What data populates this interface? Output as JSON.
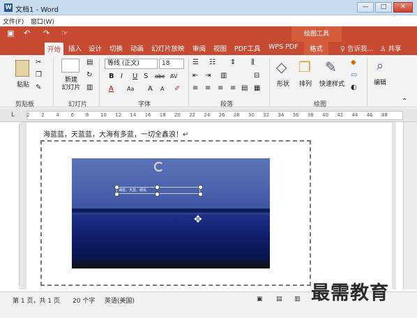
{
  "window": {
    "title": "文档1 - Word",
    "app_icon": "W",
    "min_label": "—",
    "max_label": "□",
    "close_label": "✕"
  },
  "menu": [
    "文件(F)",
    "窗口(W)"
  ],
  "qat": {
    "save": "▣",
    "undo": "↶",
    "redo": "↷",
    "custom": "☞"
  },
  "context_header": "绘图工具",
  "tabs": [
    "开始",
    "插入",
    "设计",
    "切换",
    "动画",
    "幻灯片放映",
    "审阅",
    "视图",
    "PDF工具",
    "WPS PDF",
    "格式"
  ],
  "tell_me": "告诉我...",
  "share": "共享",
  "ribbon": {
    "clipboard": {
      "paste": "粘贴",
      "group": "剪贴板"
    },
    "slides": {
      "new_slide": "新建\n幻灯片",
      "group": "幻灯片"
    },
    "font": {
      "font_name": "等线 (正文)",
      "font_size": "18",
      "group": "字体",
      "bold": "B",
      "italic": "I",
      "underline": "U",
      "strike": "S",
      "abc": "abc",
      "av": "AV",
      "fontcolor": "A",
      "aa": "Aa",
      "grow": "A",
      "shrink": "A"
    },
    "paragraph": {
      "group": "段落"
    },
    "drawing": {
      "shapes": "形状",
      "arrange": "排列",
      "quick_styles": "快速样式",
      "group": "绘图"
    },
    "editing": {
      "edit": "编辑"
    }
  },
  "ruler": {
    "ticks": [
      "2",
      "2",
      "4",
      "6",
      "8",
      "10",
      "12",
      "14",
      "16",
      "18",
      "20",
      "22",
      "24",
      "26",
      "28",
      "30",
      "32",
      "34",
      "36",
      "38",
      "40",
      "42",
      "44",
      "46",
      "48"
    ]
  },
  "document": {
    "body_text": "海蓝蓝，天蓝蓝，大海有多蓝，一切全鑫浪！↵",
    "textbox_text": "海蓝、天蓝、都是"
  },
  "status": {
    "page": "第 1 页，共 1 页",
    "words": "20 个字",
    "lang": "英语(美国)"
  },
  "watermark": "最需教育",
  "colors": {
    "accent": "#c74b33"
  }
}
